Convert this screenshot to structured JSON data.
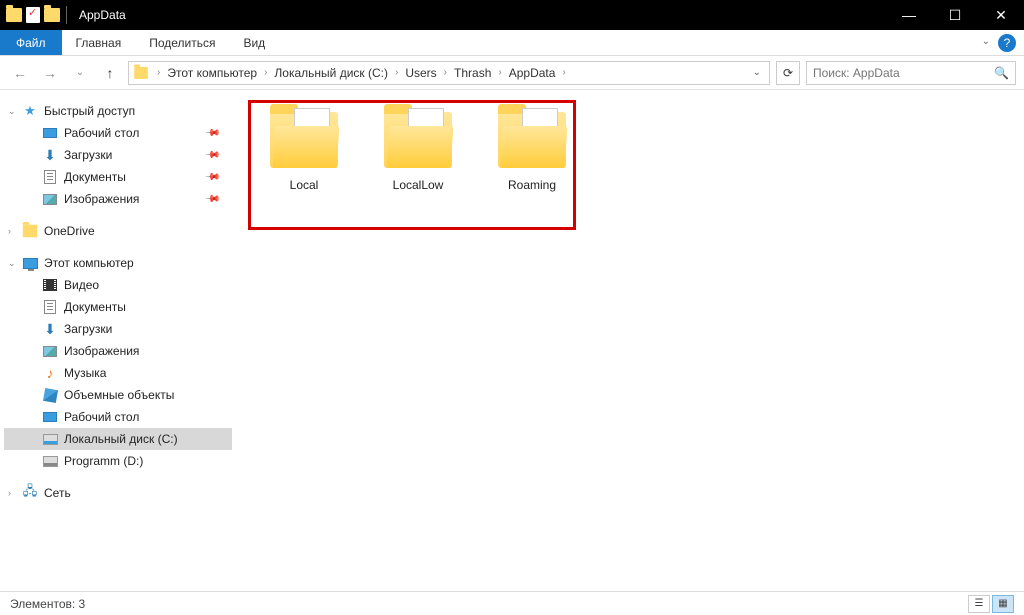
{
  "window": {
    "title": "AppData"
  },
  "ribbon": {
    "file": "Файл",
    "tabs": [
      "Главная",
      "Поделиться",
      "Вид"
    ]
  },
  "breadcrumb": {
    "items": [
      "Этот компьютер",
      "Локальный диск (C:)",
      "Users",
      "Thrash",
      "AppData"
    ]
  },
  "search": {
    "placeholder": "Поиск: AppData"
  },
  "sidebar": {
    "quick_access": "Быстрый доступ",
    "quick_items": [
      {
        "label": "Рабочий стол",
        "pin": true
      },
      {
        "label": "Загрузки",
        "pin": true
      },
      {
        "label": "Документы",
        "pin": true
      },
      {
        "label": "Изображения",
        "pin": true
      }
    ],
    "onedrive": "OneDrive",
    "this_pc": "Этот компьютер",
    "pc_items": [
      {
        "label": "Видео"
      },
      {
        "label": "Документы"
      },
      {
        "label": "Загрузки"
      },
      {
        "label": "Изображения"
      },
      {
        "label": "Музыка"
      },
      {
        "label": "Объемные объекты"
      },
      {
        "label": "Рабочий стол"
      },
      {
        "label": "Локальный диск (C:)",
        "selected": true
      },
      {
        "label": "Programm (D:)"
      }
    ],
    "network": "Сеть"
  },
  "content": {
    "folders": [
      {
        "name": "Local"
      },
      {
        "name": "LocalLow"
      },
      {
        "name": "Roaming"
      }
    ]
  },
  "statusbar": {
    "text": "Элементов: 3"
  }
}
